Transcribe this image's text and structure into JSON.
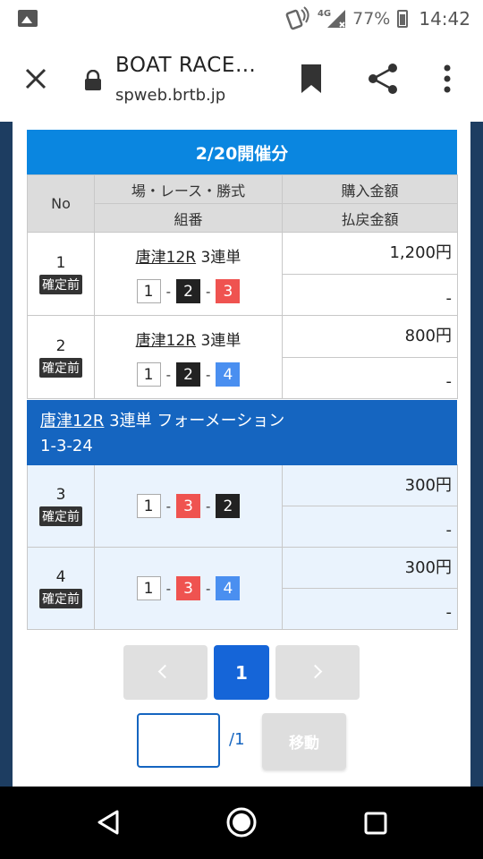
{
  "status_bar": {
    "network": "4G",
    "battery": "77%",
    "time": "14:42"
  },
  "toolbar": {
    "title": "BOAT RACE…",
    "url": "spweb.brtb.jp"
  },
  "header": {
    "date_label": "2/20開催分"
  },
  "table": {
    "col_no": "No",
    "col_race": "場・レース・勝式",
    "col_combo": "組番",
    "col_purchase": "購入金額",
    "col_payout": "払戻金額"
  },
  "rows": [
    {
      "no": "1",
      "status": "確定前",
      "venue": "唐津12R",
      "bet_type": "3連単",
      "combo": [
        "1",
        "2",
        "3"
      ],
      "amount": "1,200円",
      "payout": "-"
    },
    {
      "no": "2",
      "status": "確定前",
      "venue": "唐津12R",
      "bet_type": "3連単",
      "combo": [
        "1",
        "2",
        "4"
      ],
      "amount": "800円",
      "payout": "-"
    },
    {
      "no": "3",
      "status": "確定前",
      "combo": [
        "1",
        "3",
        "2"
      ],
      "amount": "300円",
      "payout": "-"
    },
    {
      "no": "4",
      "status": "確定前",
      "combo": [
        "1",
        "3",
        "4"
      ],
      "amount": "300円",
      "payout": "-"
    }
  ],
  "formation": {
    "venue": "唐津12R",
    "title_rest": " 3連単 フォーメーション",
    "pattern": "1-3-24"
  },
  "pagination": {
    "current": "1",
    "total": "/1",
    "input_value": "",
    "move_label": "移動"
  },
  "colors": {
    "accent_blue": "#0a86e0",
    "formation_blue": "#1565c0",
    "boat1": "#ffffff",
    "boat2": "#222222",
    "boat3": "#ef5350",
    "boat4": "#4a8ff0"
  }
}
